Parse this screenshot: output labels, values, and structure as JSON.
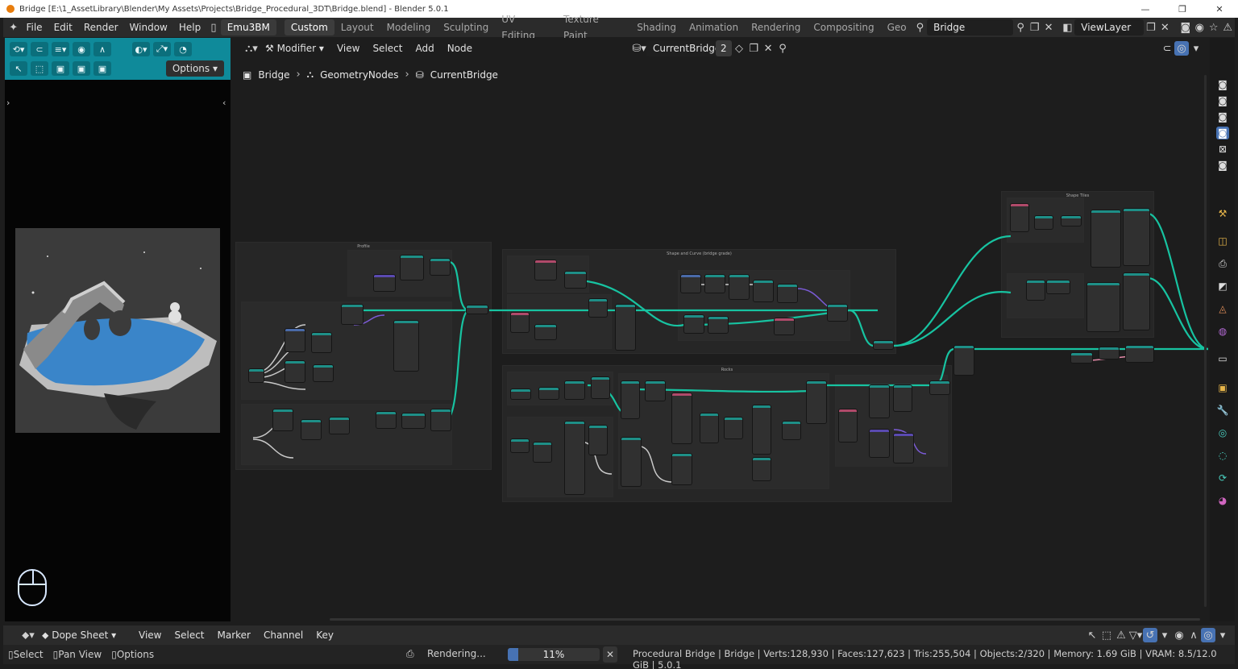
{
  "title_bar": {
    "text": "Bridge [E:\\1_AssetLibrary\\Blender\\My Assets\\Projects\\Bridge_Procedural_3DT\\Bridge.blend] - Blender 5.0.1"
  },
  "menu": {
    "items": [
      "File",
      "Edit",
      "Render",
      "Window",
      "Help"
    ],
    "addon_label": "Emu3BM"
  },
  "workspaces": [
    "Custom",
    "Layout",
    "Modeling",
    "Sculpting",
    "UV Editing",
    "Texture Paint",
    "Shading",
    "Animation",
    "Rendering",
    "Compositing",
    "Geo"
  ],
  "active_workspace": "Custom",
  "scene": {
    "name": "Bridge",
    "view_layer": "ViewLayer"
  },
  "viewport": {
    "options_label": "Options"
  },
  "node_editor": {
    "header": {
      "modifier_label": "Modifier",
      "menus": [
        "View",
        "Select",
        "Add",
        "Node"
      ],
      "node_tree": "CurrentBridge",
      "users": "2"
    },
    "breadcrumb": [
      "Bridge",
      "GeometryNodes",
      "CurrentBridge"
    ],
    "frames": {
      "profile": "Profile",
      "shape_curve": "Shape and Curve (bridge grade)",
      "rocks": "Rocks",
      "shape_tiles": "Shape Tiles"
    }
  },
  "dope_sheet": {
    "mode": "Dope Sheet",
    "menus": [
      "View",
      "Select",
      "Marker",
      "Channel",
      "Key"
    ]
  },
  "status": {
    "hints": [
      "Select",
      "Pan View",
      "Options"
    ],
    "rendering_label": "Rendering...",
    "progress_pct": 11,
    "progress_text": "11%",
    "stats": "Procedural Bridge | Bridge | Verts:128,930 | Faces:127,623 | Tris:255,504 | Objects:2/320 | Memory: 1.69 GiB | VRAM: 8.5/12.0 GiB | 5.0.1"
  },
  "colors": {
    "accent": "#0f8a9a",
    "wire": "#17c3a1",
    "progress": "#4772b3"
  }
}
